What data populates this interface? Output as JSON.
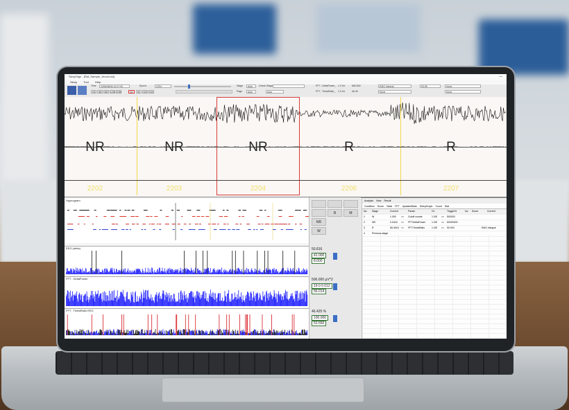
{
  "window": {
    "title": "SleepSign - [Rat_Sample_Jeucer.ssl]",
    "min_max_close": "—"
  },
  "menu": [
    "Sleep",
    "Tool",
    "Help"
  ],
  "toolbar": {
    "time_label": "Time",
    "time_value": "2006/06/06 14:07:00",
    "epoch_label": "Epoch",
    "epoch_value": "2204",
    "scale_buttons": [
      "1M",
      "3M",
      "6M",
      "12M",
      "24M",
      "4h",
      "8h",
      "12h",
      "24h"
    ],
    "stage_label": "Stage",
    "stage_value": "Auto",
    "check_stage_label": "Check Stage",
    "page_label": "Page",
    "page_value": "Auto",
    "fft_delta_label": "FFT : DeltaPower_",
    "fft_delta_range": "1.0 Hz",
    "fft_delta_value": "680 832",
    "fft_theta_label": "FFT : ThetaRatio_",
    "fft_theta_range": "1.0 Hz",
    "fft_theta_value": "46.40",
    "emg_label": "EMG integral",
    "emg_value": "53.55",
    "none1": "None",
    "none2": "None",
    "none3": "None"
  },
  "eeg": {
    "stages": [
      {
        "label": "NR",
        "epoch": "2202"
      },
      {
        "label": "NR",
        "epoch": "2203"
      },
      {
        "label": "NR",
        "epoch": "2204"
      },
      {
        "label": "R",
        "epoch": "2206"
      },
      {
        "label": "R",
        "epoch": "2207"
      }
    ]
  },
  "hypnogram": {
    "title": "Hypnogram",
    "stage_rows": [
      "W",
      "NR",
      "R"
    ]
  },
  "trends": [
    {
      "title": "EEG  (delta)",
      "value_top": "50.816",
      "value_box": "41.000",
      "value_bottom": "8.000",
      "color": "#1a1aff"
    },
    {
      "title": "FFT : DeltaPower",
      "value_top": "506.000 μV^2",
      "value_box": "19.0 0 012",
      "value_bottom": "56.014",
      "color": "#1a1aff"
    },
    {
      "title": "FFT : ThetaRatio  EEG",
      "value_top": "46.425 %",
      "value_box": "100.000",
      "value_bottom": "53.550",
      "color": "#c8131a"
    }
  ],
  "stage_buttons": {
    "r": "R",
    "m": "M",
    "nr": "NR",
    "w": "W"
  },
  "right_panel": {
    "top_tabs": [
      "Analysis",
      "View",
      "Result"
    ],
    "tabs": [
      "Condition",
      "Score",
      "Table",
      "FFT",
      "UpdatedStats",
      "SleepGraph",
      "Count",
      "Stat"
    ],
    "headers": [
      "No.",
      "Stage",
      "Current",
      "Param",
      "Ch",
      "Trigger%",
      "Inv",
      "Score",
      "Current"
    ],
    "rows": [
      {
        "no": "1",
        "stage": "W",
        "cur": "1.000",
        "op": ">=",
        "param": "Cutoff counts",
        "ch": "1.0/E",
        "cmp": ">=",
        "val": "500000",
        "extra": ""
      },
      {
        "no": "2",
        "stage": "NR",
        "cur": "0.0416",
        "op": ">=",
        "param": "FFT:DeltaPower",
        "ch": "1.0/E",
        "cmp": ">=",
        "val": "50000000",
        "extra": ""
      },
      {
        "no": "3",
        "stage": "R",
        "cur": "65.4916",
        "op": ">=",
        "param": "FFT:ThetaRatio",
        "ch": "1.0/E",
        "cmp": ">=",
        "val": "50.000",
        "extra": "EMG integral"
      },
      {
        "no": "4",
        "stage": "Previous stage",
        "cur": "",
        "op": "",
        "param": "",
        "ch": "",
        "cmp": "",
        "val": "",
        "extra": ""
      }
    ]
  }
}
